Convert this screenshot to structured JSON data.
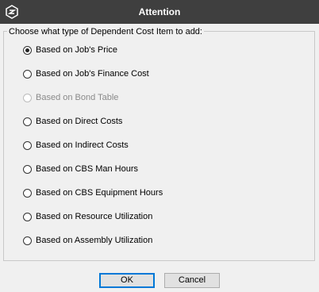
{
  "dialog": {
    "title": "Attention",
    "prompt": "Choose what type of Dependent Cost Item to add:",
    "options": [
      {
        "label": "Based on Job's Price",
        "checked": true,
        "disabled": false
      },
      {
        "label": "Based on Job's Finance Cost",
        "checked": false,
        "disabled": false
      },
      {
        "label": "Based on Bond Table",
        "checked": false,
        "disabled": true
      },
      {
        "label": "Based on Direct Costs",
        "checked": false,
        "disabled": false
      },
      {
        "label": "Based on Indirect Costs",
        "checked": false,
        "disabled": false
      },
      {
        "label": "Based on CBS Man Hours",
        "checked": false,
        "disabled": false
      },
      {
        "label": "Based on CBS Equipment Hours",
        "checked": false,
        "disabled": false
      },
      {
        "label": "Based on Resource Utilization",
        "checked": false,
        "disabled": false
      },
      {
        "label": "Based on Assembly Utilization",
        "checked": false,
        "disabled": false
      }
    ],
    "ok_label": "OK",
    "cancel_label": "Cancel"
  },
  "icons": {
    "app": "app-logo-icon"
  },
  "colors": {
    "titlebar": "#3f3f3f",
    "background": "#f0f0f0",
    "default_button_border": "#0078d7"
  }
}
